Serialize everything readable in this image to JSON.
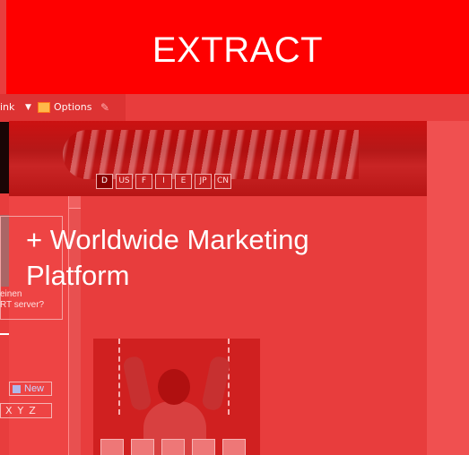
{
  "overlay": {
    "banner_title": "EXTRACT",
    "headline": "+ Worldwide Marketing Platform"
  },
  "browser": {
    "toolbar": {
      "link_label": "ink",
      "options_label": "Options"
    }
  },
  "page": {
    "languages": [
      "D",
      "US",
      "F",
      "I",
      "E",
      "JP",
      "CN"
    ],
    "active_language": "D",
    "server_prompt_line1": "einen",
    "server_prompt_line2": "RT server?",
    "new_button_label": "New",
    "alpha_nav": [
      "X",
      "Y",
      "Z"
    ]
  },
  "colors": {
    "overlay_red": "#fe0000",
    "page_red": "#e83d3d"
  },
  "icons": {
    "options_icon": "outlook-options-icon",
    "pencil_icon": "pencil-icon",
    "new_icon": "document-icon"
  }
}
